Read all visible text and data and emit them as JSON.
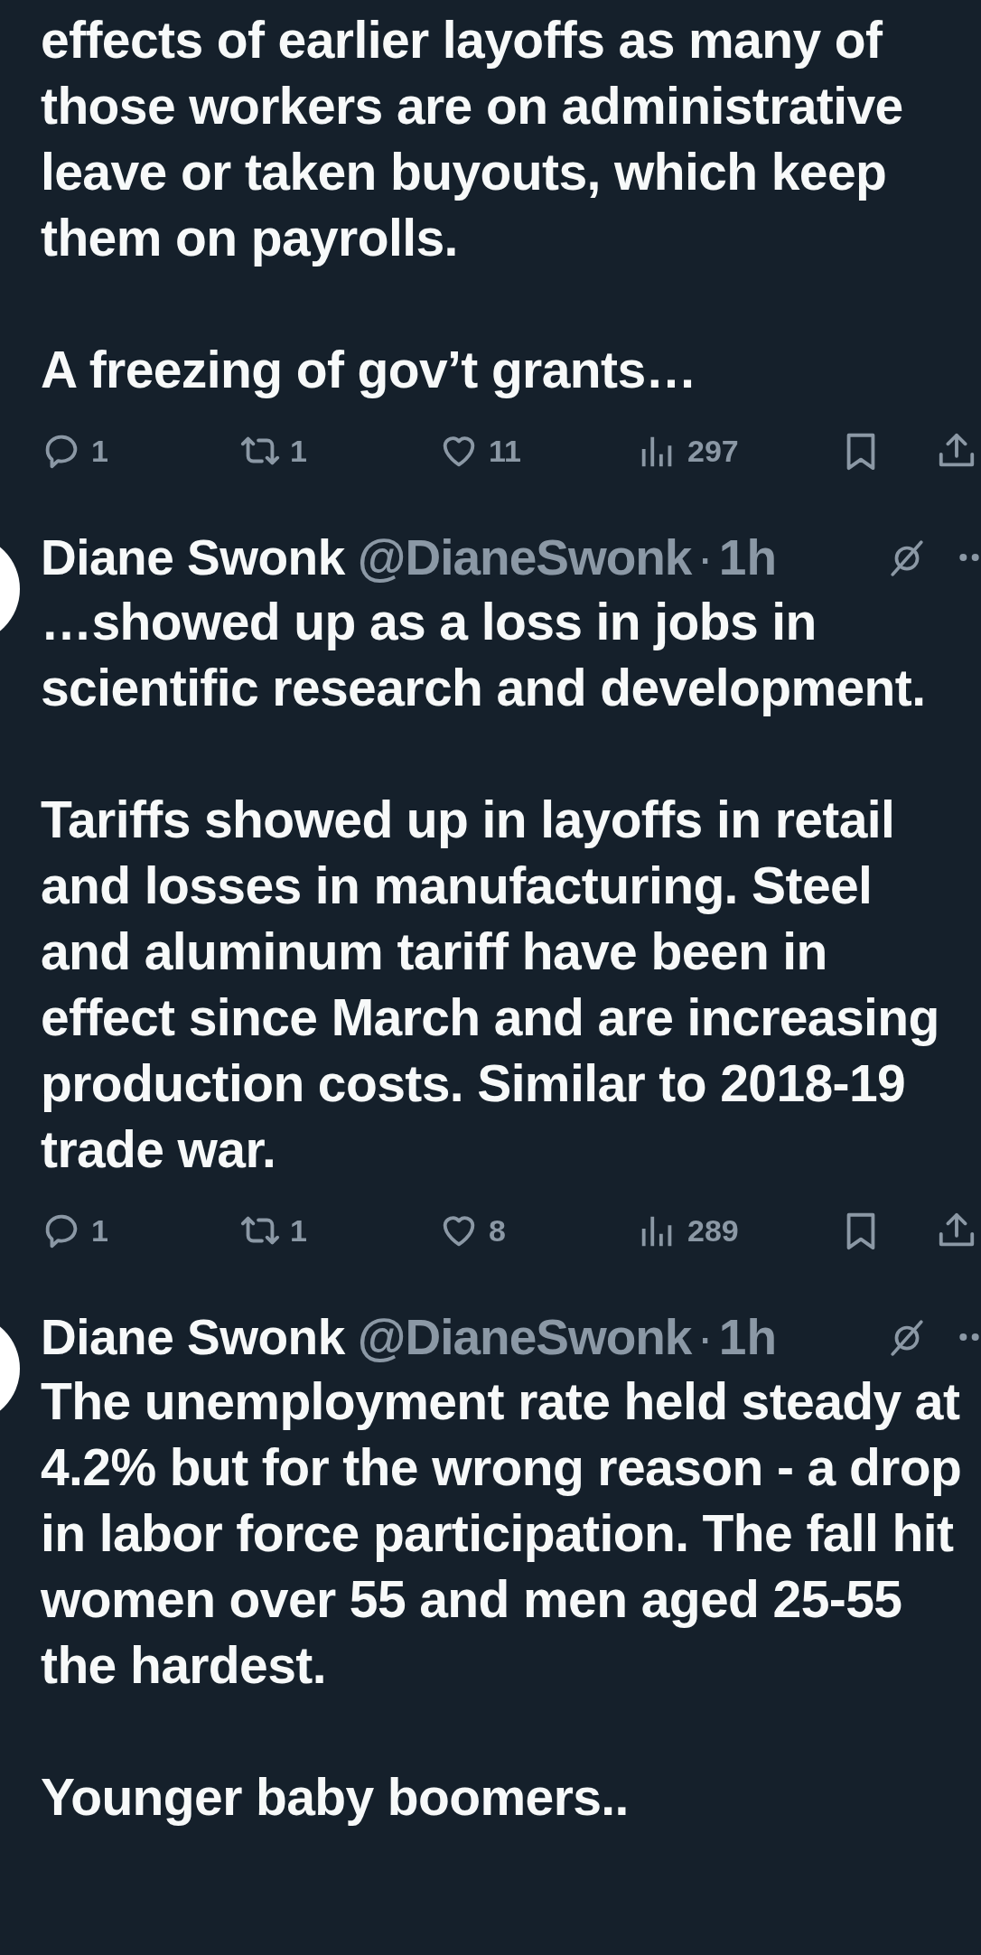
{
  "tweets": [
    {
      "paragraphs": [
        "effects of earlier layoffs as many of those workers are on administrative leave or taken buyouts, which keep them on payrolls.",
        "A freezing of gov’t grants…"
      ],
      "actions": {
        "replies": "1",
        "reposts": "1",
        "likes": "11",
        "views": "297"
      }
    },
    {
      "author": {
        "name": "Diane Swonk",
        "handle": "@DianeSwonk",
        "separator": "·",
        "time": "1h"
      },
      "paragraphs": [
        "…showed up as a loss in jobs in scientific research and development.",
        "Tariffs showed up in layoffs in retail and losses in manufacturing. Steel and aluminum tariff have been in effect since March and are increasing production costs. Similar to 2018-19 trade war."
      ],
      "actions": {
        "replies": "1",
        "reposts": "1",
        "likes": "8",
        "views": "289"
      }
    },
    {
      "author": {
        "name": "Diane Swonk",
        "handle": "@DianeSwonk",
        "separator": "·",
        "time": "1h"
      },
      "paragraphs": [
        "The unemployment rate held steady at 4.2% but for the wrong reason - a drop in labor force participation. The fall hit women over 55 and men aged 25-55 the hardest.",
        "Younger baby boomers.."
      ]
    }
  ]
}
